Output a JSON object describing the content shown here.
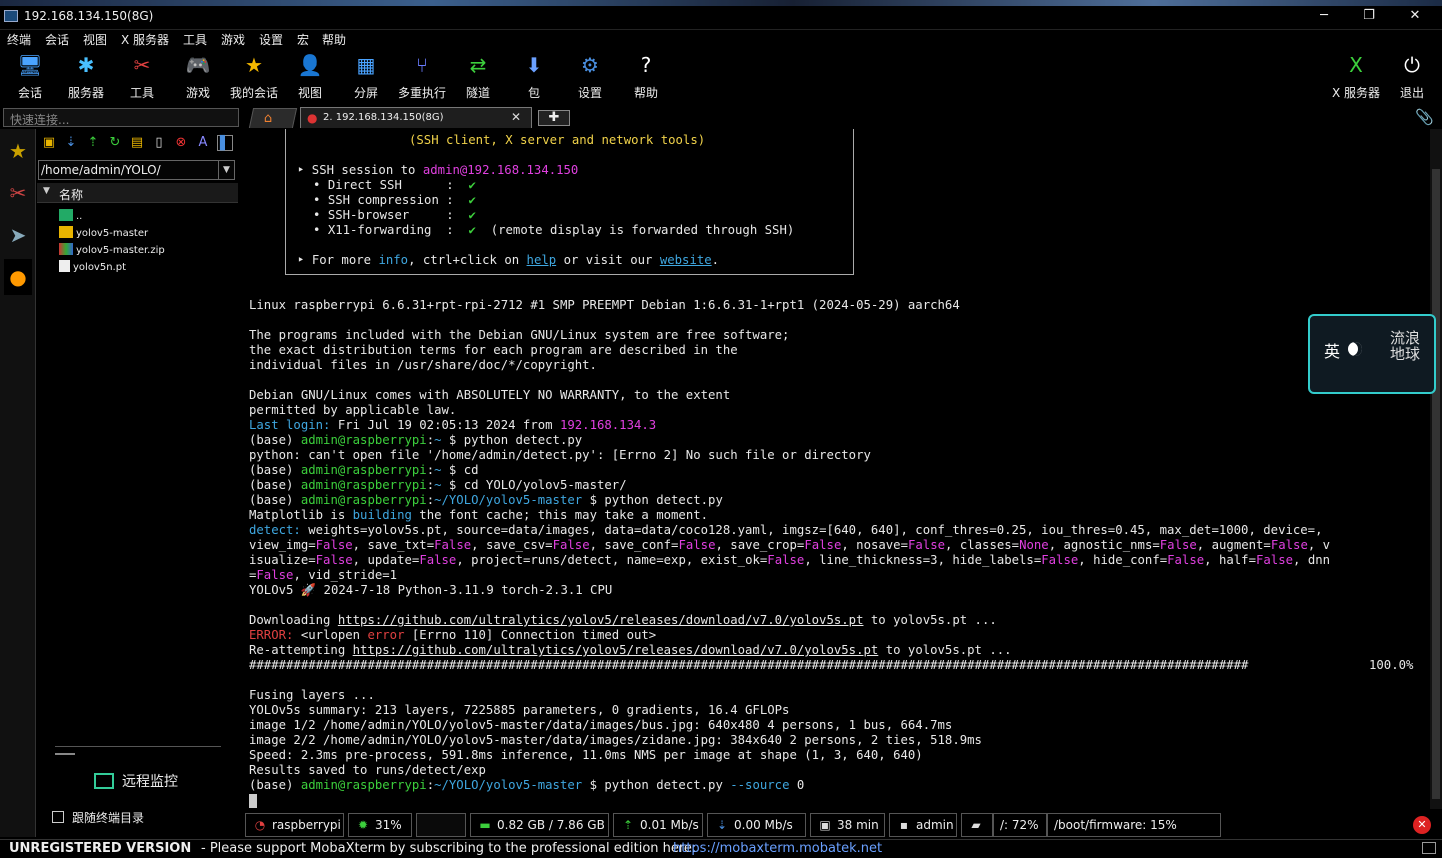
{
  "window": {
    "title": "192.168.134.150(8G)",
    "minimize": "─",
    "maximize": "❐",
    "close": "✕"
  },
  "menu": [
    "终端",
    "会话",
    "视图",
    "X 服务器",
    "工具",
    "游戏",
    "设置",
    "宏",
    "帮助"
  ],
  "toolbar": {
    "left": [
      {
        "label": "会话",
        "icon": "session-icon",
        "glyph": "🖥",
        "color": "#4aa3ff"
      },
      {
        "label": "服务器",
        "icon": "servers-icon",
        "glyph": "✱",
        "color": "#49c0ff"
      },
      {
        "label": "工具",
        "icon": "tools-icon",
        "glyph": "✂",
        "color": "#e04040"
      },
      {
        "label": "游戏",
        "icon": "games-icon",
        "glyph": "🎮",
        "color": "#cccccc"
      },
      {
        "label": "我的会话",
        "icon": "star-icon",
        "glyph": "★",
        "color": "#f5b800"
      },
      {
        "label": "视图",
        "icon": "view-icon",
        "glyph": "👤",
        "color": "#9ccf6a"
      },
      {
        "label": "分屏",
        "icon": "split-icon",
        "glyph": "▦",
        "color": "#4aa3ff"
      },
      {
        "label": "多重执行",
        "icon": "multiexec-icon",
        "glyph": "⑂",
        "color": "#6a7cff"
      },
      {
        "label": "隧道",
        "icon": "tunnel-icon",
        "glyph": "⇄",
        "color": "#3ccf3c"
      },
      {
        "label": "包",
        "icon": "packages-icon",
        "glyph": "⬇",
        "color": "#6aa0ff"
      },
      {
        "label": "设置",
        "icon": "settings-icon",
        "glyph": "⚙",
        "color": "#4a8fe0"
      },
      {
        "label": "帮助",
        "icon": "help-icon",
        "glyph": "?",
        "color": "#ffffff"
      }
    ],
    "right": [
      {
        "label": "X 服务器",
        "icon": "xserver-icon",
        "glyph": "X",
        "color": "#3ccf3c"
      },
      {
        "label": "退出",
        "icon": "exit-icon",
        "glyph": "⏻",
        "color": "#ffffff"
      }
    ]
  },
  "quick_connect": {
    "placeholder": "快速连接..."
  },
  "tabs": {
    "home_glyph": "⌂",
    "session_label": "2. 192.168.134.150(8G)",
    "close": "✕",
    "new": "✚",
    "attach": "📎"
  },
  "sidebar": {
    "path": "/home/admin/YOLO/",
    "column_header": "名称",
    "files": [
      {
        "name": "..",
        "kind": "up"
      },
      {
        "name": "yolov5-master",
        "kind": "folder"
      },
      {
        "name": "yolov5-master.zip",
        "kind": "zip"
      },
      {
        "name": "yolov5n.pt",
        "kind": "file"
      }
    ],
    "remote_monitor": "远程监控",
    "follow_terminal": "跟随终端目录"
  },
  "terminal": {
    "banner_top": "(SSH client, X server and network tools)",
    "ssh_to": "admin@192.168.134.150",
    "features": [
      {
        "name": "Direct SSH",
        "ok": "✔"
      },
      {
        "name": "SSH compression",
        "ok": "✔"
      },
      {
        "name": "SSH-browser",
        "ok": "✔"
      },
      {
        "name": "X11-forwarding",
        "ok": "✔",
        "note": "(remote display is forwarded through SSH)"
      }
    ],
    "more_info": {
      "prefix": "For more ",
      "info": "info",
      "mid": ", ctrl+click on ",
      "help": "help",
      "mid2": " or visit our ",
      "website": "website",
      "end": "."
    },
    "kernel": "Linux raspberrypi 6.6.31+rpt-rpi-2712 #1 SMP PREEMPT Debian 1:6.6.31-1+rpt1 (2024-05-29) aarch64",
    "programs": [
      "The programs included with the Debian GNU/Linux system are free software;",
      "the exact distribution terms for each program are described in the",
      "individual files in /usr/share/doc/*/copyright."
    ],
    "warranty": [
      "Debian GNU/Linux comes with ABSOLUTELY NO WARRANTY, to the extent",
      "permitted by applicable law."
    ],
    "last_login_label": "Last login:",
    "last_login": " Fri Jul 19 02:05:13 2024 from ",
    "last_login_ip": "192.168.134.3",
    "prompt_base": "(base) ",
    "prompt_user": "admin@raspberrypi",
    "cmd1": "python detect.py",
    "err1": "python: can't open file '/home/admin/detect.py': [Errno 2] No such file or directory",
    "cmd2": "cd",
    "cmd3": "cd YOLO/yolov5-master/",
    "cwd": "~/YOLO/yolov5-master",
    "cmd4": "python detect.py",
    "matplotlib": [
      "Matplotlib is ",
      "building",
      " the font cache; this may take a moment."
    ],
    "detect_label": "detect:",
    "yolo_version": "YOLOv5 🚀 2024-7-18 Python-3.11.9 torch-2.3.1 CPU",
    "download_prefix": "Downloading ",
    "download_url": "https://github.com/ultralytics/yolov5/releases/download/v7.0/yolov5s.pt",
    "download_suffix": " to yolov5s.pt ...",
    "error_label": "ERROR:",
    "error_text": " <urlopen ",
    "error_word": "error",
    "error_rest": " [Errno 110] Connection timed out>",
    "retry_prefix": "Re-attempting ",
    "progress_bar": "#######################################################################################################################################",
    "progress_pct": "100.0%",
    "fusing": "Fusing layers ...",
    "summary": "YOLOv5s summary: 213 layers, 7225885 parameters, 0 gradients, 16.4 GFLOPs",
    "image1": "image 1/2 /home/admin/YOLO/yolov5-master/data/images/bus.jpg: 640x480 4 persons, 1 bus, 664.7ms",
    "image2": "image 2/2 /home/admin/YOLO/yolov5-master/data/images/zidane.jpg: 384x640 2 persons, 2 ties, 518.9ms",
    "speed": "Speed: 2.3ms pre-process, 591.8ms inference, 11.0ms NMS per image at shape (1, 3, 640, 640)",
    "saved": "Results saved to runs/detect/exp",
    "cmd5": "python detect.py ",
    "cmd5_flag": "--source",
    "cmd5_arg": " 0"
  },
  "widget": {
    "char1": "英",
    "script": "流浪\n地球"
  },
  "statusbar": [
    {
      "label": "raspberrypi",
      "icon": "raspberry-icon",
      "glyph": "◔",
      "color": "#e04040"
    },
    {
      "label": "31%",
      "icon": "cpu-icon",
      "glyph": "✹",
      "color": "#3ccf3c"
    },
    {
      "label": "",
      "icon": "cpu-graph-icon",
      "glyph": "",
      "color": "#111111"
    },
    {
      "label": "0.82 GB / 7.86 GB",
      "icon": "memory-icon",
      "glyph": "▬",
      "color": "#3ccf3c"
    },
    {
      "label": "0.01 Mb/s",
      "icon": "upload-icon",
      "glyph": "⇡",
      "color": "#3ccf3c"
    },
    {
      "label": "0.00 Mb/s",
      "icon": "download-icon",
      "glyph": "⇣",
      "color": "#4a8fe0"
    },
    {
      "label": "38 min",
      "icon": "uptime-icon",
      "glyph": "▣",
      "color": "#dddddd"
    },
    {
      "label": "admin",
      "icon": "user-icon",
      "glyph": "▪",
      "color": "#dddddd"
    },
    {
      "label": "",
      "icon": "disk-icon",
      "glyph": "▰",
      "color": "#dddddd"
    },
    {
      "label": "/: 72%",
      "icon": "",
      "glyph": "",
      "color": "#eeeeee"
    },
    {
      "label": "/boot/firmware: 15%",
      "icon": "",
      "glyph": "",
      "color": "#eeeeee"
    }
  ],
  "bottombar": {
    "unregistered": "UNREGISTERED VERSION",
    "message": " -  Please support MobaXterm by subscribing to the professional edition here:",
    "link": "https://mobaxterm.mobatek.net"
  }
}
